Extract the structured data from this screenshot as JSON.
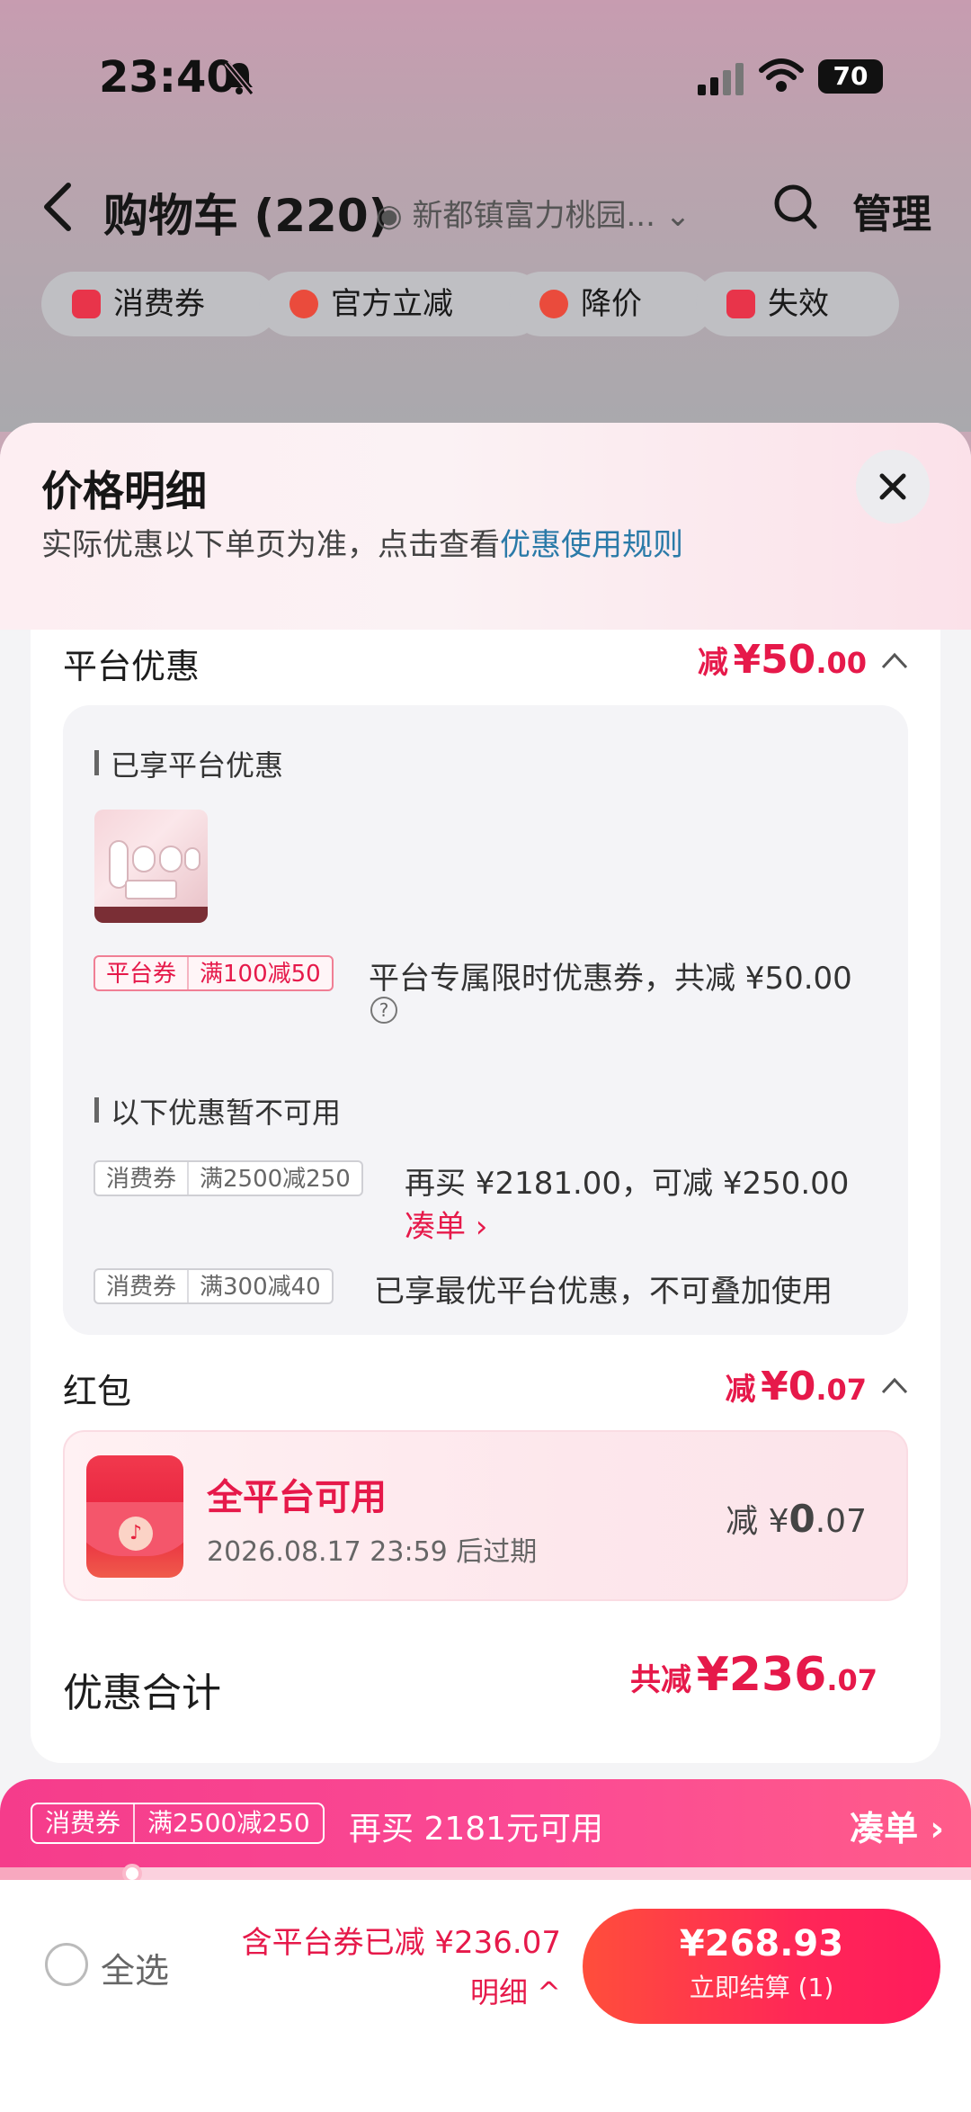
{
  "status": {
    "time": "23:40",
    "battery": "70"
  },
  "header": {
    "title": "购物车 (220)",
    "location": "新都镇富力桃园...",
    "manage": "管理"
  },
  "chips": [
    "消费券",
    "官方立减",
    "降价",
    "失效"
  ],
  "sheet": {
    "title": "价格明细",
    "subtitle": "实际优惠以下单页为准，点击查看",
    "rule_link": "优惠使用规则",
    "platform": {
      "title": "平台优惠",
      "prefix": "减",
      "amount_int": "¥50",
      "amount_dec": ".00",
      "enjoyed_title": "已享平台优惠",
      "coupon_tag": "平台券",
      "coupon_rule": "满100减50",
      "coupon_desc": "平台专属限时优惠券，共减 ¥50.00",
      "unavailable_title": "以下优惠暂不可用",
      "items": [
        {
          "tag": "消费券",
          "rule": "满2500减250",
          "desc": "再买 ¥2181.00，可减 ¥250.00",
          "link": "凑单 ›"
        },
        {
          "tag": "消费券",
          "rule": "满300减40",
          "desc": "已享最优平台优惠，不可叠加使用"
        }
      ]
    },
    "redpacket": {
      "title": "红包",
      "prefix": "减",
      "amount_int": "¥0",
      "amount_dec": ".07",
      "card_title": "全平台可用",
      "expiry": "2026.08.17 23:59 后过期",
      "card_prefix": "减 ¥",
      "card_int": "0",
      "card_dec": ".07"
    },
    "total": {
      "label": "优惠合计",
      "prefix": "共减",
      "amount_int": "¥236",
      "amount_dec": ".07"
    }
  },
  "promo": {
    "tag": "消费券",
    "rule": "满2500减250",
    "text": "再买 2181元可用",
    "link": "凑单 ›",
    "progress": 0.136
  },
  "bottom": {
    "select_all": "全选",
    "saved": "含平台券已减 ¥236.07",
    "detail": "明细 ^",
    "price": "¥268.93",
    "checkout": "立即结算 (1)"
  },
  "colors": {
    "accent": "#e6194a",
    "link": "#2a7aa8",
    "promo": "#f53c8b",
    "checkout": "#ff2757"
  }
}
